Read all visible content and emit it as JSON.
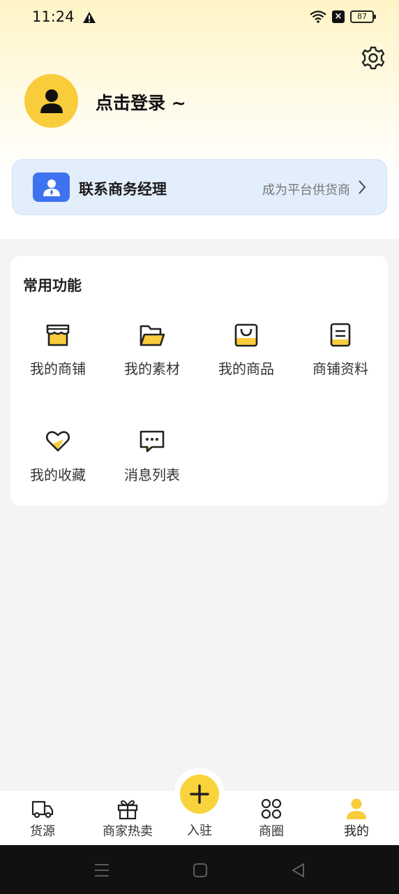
{
  "status_bar": {
    "time": "11:24",
    "battery": "87"
  },
  "profile": {
    "login_text": "点击登录 ~"
  },
  "manager": {
    "title": "联系商务经理",
    "subtitle": "成为平台供货商"
  },
  "functions": {
    "title": "常用功能",
    "items": [
      {
        "label": "我的商铺",
        "icon": "store-icon"
      },
      {
        "label": "我的素材",
        "icon": "folder-icon"
      },
      {
        "label": "我的商品",
        "icon": "shopping-bag-icon"
      },
      {
        "label": "商铺资料",
        "icon": "document-icon"
      },
      {
        "label": "我的收藏",
        "icon": "heart-icon"
      },
      {
        "label": "消息列表",
        "icon": "message-icon"
      }
    ]
  },
  "bottom_nav": {
    "items": [
      {
        "label": "货源",
        "icon": "truck-icon"
      },
      {
        "label": "商家热卖",
        "icon": "gift-icon"
      },
      {
        "label": "入驻",
        "icon": "plus-icon"
      },
      {
        "label": "商圈",
        "icon": "grid-icon"
      },
      {
        "label": "我的",
        "icon": "person-icon"
      }
    ],
    "active_index": 4
  },
  "colors": {
    "accent": "#f9cc3c",
    "manager_blue": "#3e73f0",
    "card_bg": "#e3eefc"
  }
}
